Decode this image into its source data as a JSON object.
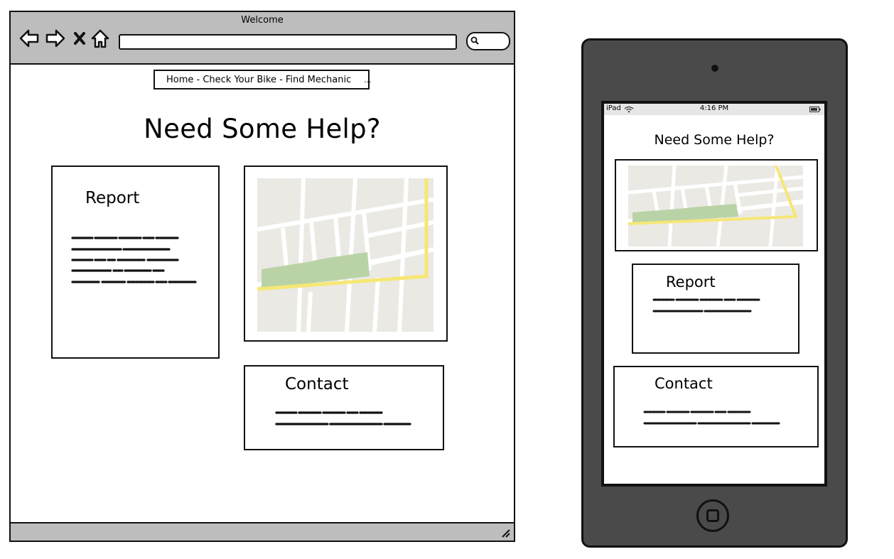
{
  "browser": {
    "title": "Welcome",
    "breadcrumb": {
      "text": "Home -  Check Your Bike - Find Mechanic",
      "overflow": "..."
    }
  },
  "page": {
    "heading": "Need Some Help?",
    "report_title": "Report",
    "contact_title": "Contact"
  },
  "ipad": {
    "carrier": "iPad",
    "time": "4:16 PM",
    "heading": "Need Some Help?",
    "report_title": "Report",
    "contact_title": "Contact"
  },
  "colors": {
    "chrome_gray": "#bdbdbd",
    "device_body": "#4a4a4a",
    "map_land": "#ebe9e4",
    "map_park": "#b9d3a7",
    "map_highway": "#f6e776"
  },
  "icons": [
    "back-arrow-icon",
    "forward-arrow-icon",
    "close-icon",
    "home-icon",
    "search-icon",
    "wifi-icon",
    "battery-icon",
    "resize-grip-icon",
    "camera-icon",
    "home-button-icon"
  ]
}
